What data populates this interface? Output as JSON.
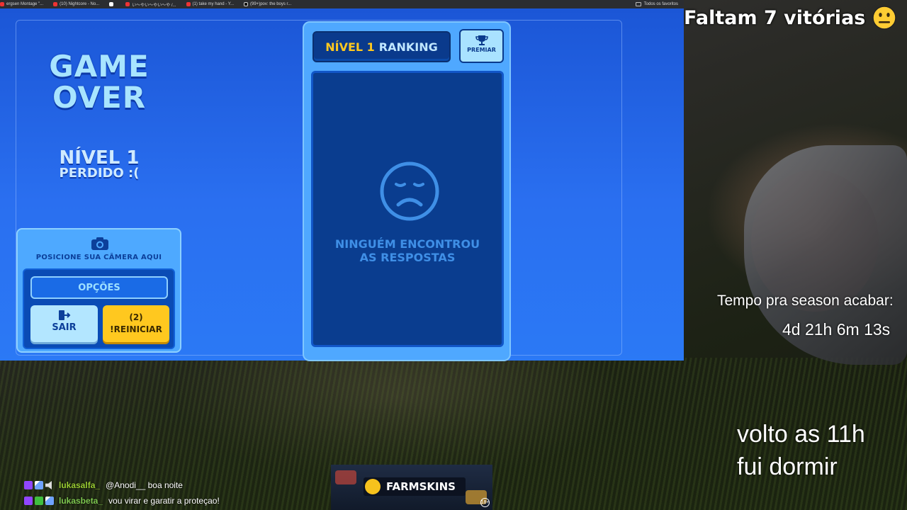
{
  "browser": {
    "bookmarks": [
      {
        "label": "ergsen Montage \"...",
        "icon": "youtube-icon"
      },
      {
        "label": "(10) Nightcore - No...",
        "icon": "youtube-icon"
      },
      {
        "label": "",
        "icon": "x-icon"
      },
      {
        "label": "い〜やい〜やい〜や /...",
        "icon": "youtube-icon"
      },
      {
        "label": "(1) take my hand - Y...",
        "icon": "youtube-icon"
      },
      {
        "label": "(99+)pov: the boys r...",
        "icon": "tiktok-icon"
      }
    ],
    "all_bookmarks_label": "Todos os favoritos"
  },
  "game": {
    "game_over_line1": "GAME",
    "game_over_line2": "OVER",
    "level_label": "NÍVEL 1",
    "level_status": "PERDIDO :(",
    "camera_label": "POSICIONE SUA CÂMERA AQUI",
    "options_button": "OPÇÕES",
    "exit_button": "SAIR",
    "restart_count": "(2)",
    "restart_button": "!REINICIAR",
    "ranking_level": "NÍVEL 1",
    "ranking_title": "RANKING",
    "award_button": "PREMIAR",
    "empty_message_line1": "NINGUÉM ENCONTROU",
    "empty_message_line2": "AS RESPOSTAS"
  },
  "overlay": {
    "wins_remaining": "Faltam 7 vitórias",
    "season_label": "Tempo pra season acabar:",
    "season_countdown": "4d 21h 6m 13s",
    "away_line1": "volto as 11h",
    "away_line2": "fui dormir"
  },
  "chat": [
    {
      "user": "lukasalfa_",
      "message": "@Anodi__ boa noite"
    },
    {
      "user": "lukasbeta_",
      "message": "vou virar e garatir a proteçao!"
    }
  ],
  "ad": {
    "brand": "FARMSKINS",
    "age_rating": "18+"
  },
  "colors": {
    "game_bg": "#2a6ff0",
    "accent_yellow": "#ffc81f",
    "panel_dark": "#0a3d8f"
  }
}
